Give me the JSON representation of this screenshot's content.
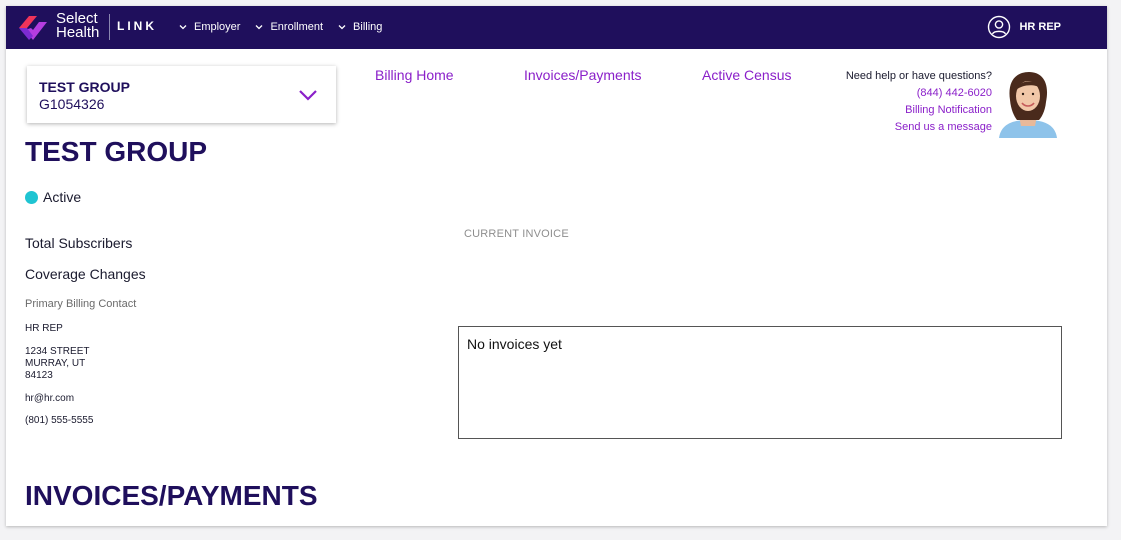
{
  "header": {
    "brand_line1": "Select",
    "brand_line2": "Health",
    "product": "LINK",
    "menu": [
      {
        "label": "Employer"
      },
      {
        "label": "Enrollment"
      },
      {
        "label": "Billing"
      }
    ],
    "user_label": "HR REP"
  },
  "group_selector": {
    "name": "TEST GROUP",
    "id": "G1054326"
  },
  "group": {
    "title": "TEST GROUP",
    "status": "Active",
    "total_subscribers_label": "Total Subscribers",
    "coverage_changes_label": "Coverage Changes",
    "primary_contact_label": "Primary Billing Contact",
    "contact_name": "HR REP",
    "address_line1": "1234 STREET",
    "address_line2": "MURRAY, UT",
    "address_line3": "84123",
    "email": "hr@hr.com",
    "phone": "(801) 555-5555"
  },
  "billing_tabs": [
    {
      "label": "Billing Home"
    },
    {
      "label": "Invoices/Payments"
    },
    {
      "label": "Active Census"
    }
  ],
  "help": {
    "question": "Need help or have questions?",
    "phone": "(844) 442-6020",
    "notification_link": "Billing Notification",
    "message_link": "Send us a message"
  },
  "invoice": {
    "heading": "CURRENT INVOICE",
    "empty_text": "No invoices yet"
  },
  "sections": {
    "invoices_title": "INVOICES/PAYMENTS"
  },
  "colors": {
    "navy": "#1f0f5c",
    "purple_link": "#8a1fc9",
    "active_dot": "#1fc4d2"
  }
}
